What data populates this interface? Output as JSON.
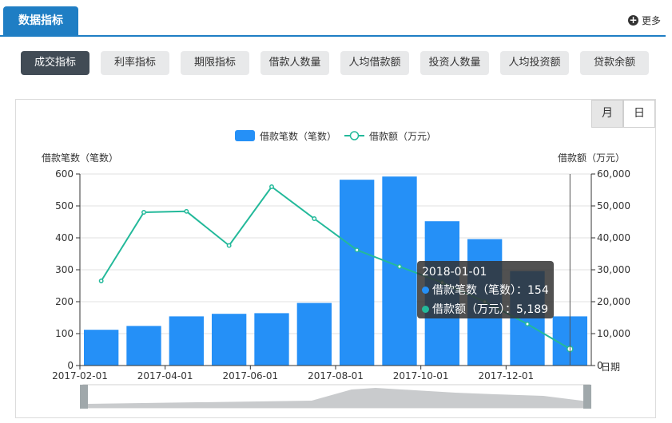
{
  "header": {
    "title": "数据指标",
    "more_label": "更多"
  },
  "metric_tabs": [
    "成交指标",
    "利率指标",
    "期限指标",
    "借款人数量",
    "人均借款额",
    "投资人数量",
    "人均投资额",
    "贷款余额"
  ],
  "period_buttons": [
    "月",
    "日"
  ],
  "colors": {
    "bar": "#2590f7",
    "line": "#23b99a",
    "accent": "#1f7ec4"
  },
  "chart_data": {
    "type": "bar",
    "legend": [
      "借款笔数（笔数）",
      "借款额（万元）"
    ],
    "ylabel": "借款笔数（笔数）",
    "ylabel_right": "借款额（万元）",
    "xlabel": "日期",
    "ylim": [
      0,
      600
    ],
    "ylim_right": [
      0,
      60000
    ],
    "yticks": [
      "0",
      "100",
      "200",
      "300",
      "400",
      "500",
      "600"
    ],
    "yticks_right": [
      "0",
      "10,000",
      "20,000",
      "30,000",
      "40,000",
      "50,000",
      "60,000"
    ],
    "x_tick_labels": [
      "2017-02-01",
      "2017-04-01",
      "2017-06-01",
      "2017-08-01",
      "2017-10-01",
      "2017-12-01"
    ],
    "categories": [
      "2017-02-01",
      "2017-03-01",
      "2017-04-01",
      "2017-05-01",
      "2017-06-01",
      "2017-07-01",
      "2017-08-01",
      "2017-09-01",
      "2017-10-01",
      "2017-11-01",
      "2017-12-01",
      "2018-01-01"
    ],
    "series": [
      {
        "name": "借款笔数（笔数）",
        "type": "bar",
        "axis": "left",
        "values": [
          112,
          124,
          154,
          162,
          164,
          196,
          582,
          592,
          452,
          396,
          296,
          154
        ]
      },
      {
        "name": "借款额（万元）",
        "type": "line",
        "axis": "right",
        "values": [
          26500,
          48000,
          48300,
          37600,
          56000,
          46000,
          36200,
          31000,
          26000,
          20000,
          13000,
          5189
        ]
      }
    ],
    "tooltip": {
      "title": "2018-01-01",
      "rows": [
        "借款笔数（笔数）：154",
        "借款额（万元）：5,189"
      ]
    }
  }
}
